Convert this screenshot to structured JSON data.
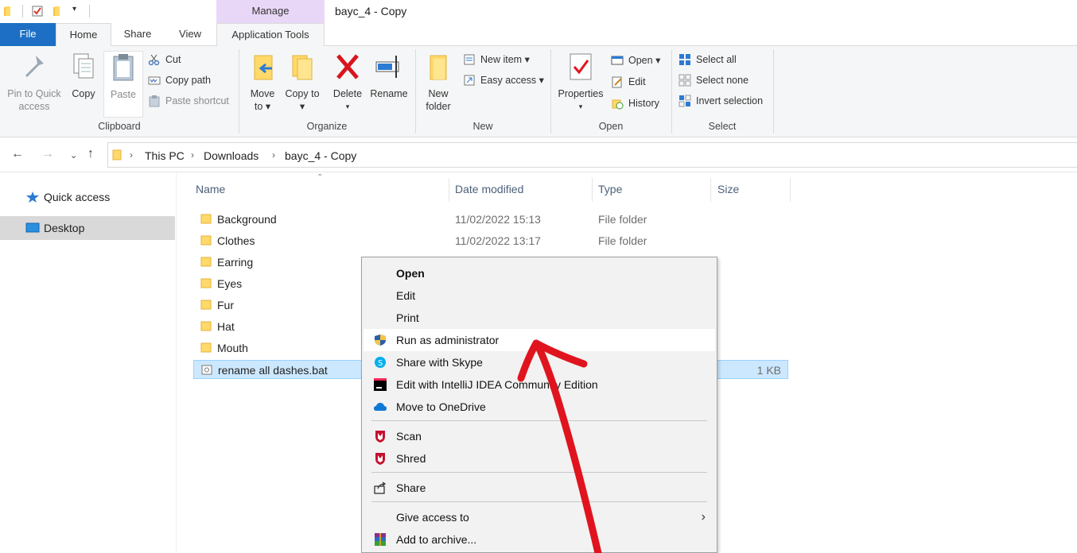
{
  "window": {
    "title": "bayc_4 - Copy",
    "context_tab_header": "Manage"
  },
  "tabs": {
    "file": "File",
    "home": "Home",
    "share": "Share",
    "view": "View",
    "app_tools": "Application Tools"
  },
  "ribbon": {
    "clipboard": {
      "label": "Clipboard",
      "pin": "Pin to Quick access",
      "copy": "Copy",
      "paste": "Paste",
      "cut": "Cut",
      "copy_path": "Copy path",
      "paste_shortcut": "Paste shortcut"
    },
    "organize": {
      "label": "Organize",
      "move_to": "Move to",
      "copy_to": "Copy to",
      "delete": "Delete",
      "rename": "Rename"
    },
    "new": {
      "label": "New",
      "new_folder": "New folder",
      "new_item": "New item",
      "easy_access": "Easy access"
    },
    "open": {
      "label": "Open",
      "properties": "Properties",
      "open": "Open",
      "edit": "Edit",
      "history": "History"
    },
    "select": {
      "label": "Select",
      "select_all": "Select all",
      "select_none": "Select none",
      "invert_selection": "Invert selection"
    }
  },
  "address": {
    "crumbs": [
      "This PC",
      "Downloads",
      "bayc_4 - Copy"
    ]
  },
  "nav_pane": {
    "items": [
      "Quick access",
      "Desktop"
    ]
  },
  "columns": {
    "name": "Name",
    "date": "Date modified",
    "type": "Type",
    "size": "Size"
  },
  "files": [
    {
      "name": "Background",
      "date": "11/02/2022 15:13",
      "type": "File folder",
      "size": ""
    },
    {
      "name": "Clothes",
      "date": "11/02/2022 13:17",
      "type": "File folder",
      "size": ""
    },
    {
      "name": "Earring",
      "date": "",
      "type": "",
      "size": ""
    },
    {
      "name": "Eyes",
      "date": "",
      "type": "",
      "size": ""
    },
    {
      "name": "Fur",
      "date": "",
      "type": "",
      "size": ""
    },
    {
      "name": "Hat",
      "date": "",
      "type": "",
      "size": ""
    },
    {
      "name": "Mouth",
      "date": "",
      "type": "",
      "size": ""
    },
    {
      "name": "rename all dashes.bat",
      "date": "",
      "type": "",
      "size": "1 KB"
    }
  ],
  "context_menu": {
    "items": [
      "Open",
      "Edit",
      "Print",
      "Run as administrator",
      "Share with Skype",
      "Edit with IntelliJ IDEA Community Edition",
      "Move to OneDrive",
      "Scan",
      "Shred",
      "Share",
      "Give access to",
      "Add to archive..."
    ],
    "submenu_arrow": "›"
  },
  "colors": {
    "file_tab": "#1c6fc4",
    "manage_tab": "#e9d7f7",
    "selection": "#cce8ff",
    "annotation": "#e0141e"
  }
}
